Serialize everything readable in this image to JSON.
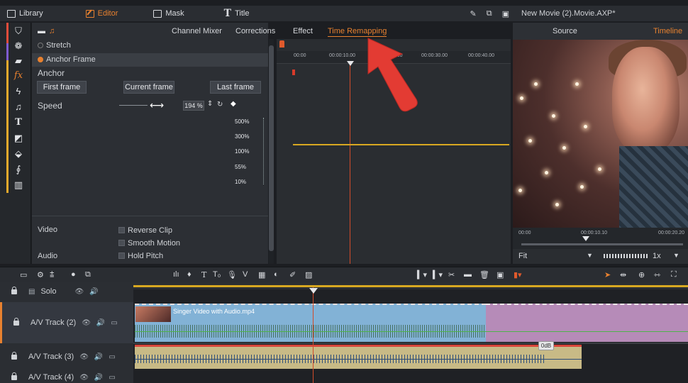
{
  "menubar": {
    "items": [
      {
        "label": "Library",
        "icon": "library-icon"
      },
      {
        "label": "Editor",
        "icon": "editor-pen-icon",
        "active": true
      },
      {
        "label": "Mask",
        "icon": "mask-icon"
      },
      {
        "label": "Title",
        "icon": "title-t-icon"
      }
    ],
    "right_icons": [
      "pencil-icon",
      "copy-icon",
      "layout-icon"
    ],
    "project_title": "New Movie (2).Movie.AXP*"
  },
  "panel": {
    "tabs": [
      "Channel Mixer",
      "Corrections",
      "Effect",
      "Time Remapping"
    ],
    "active_tab": "Time Remapping",
    "stretch_label": "Stretch",
    "anchor_frame_label": "Anchor Frame",
    "anchor_label": "Anchor",
    "first_frame": "First frame",
    "current_frame": "Current frame",
    "last_frame": "Last frame",
    "speed_label": "Speed",
    "speed_value": "194 %",
    "speed_scale": [
      "500%",
      "300%",
      "100%",
      "55%",
      "10%"
    ],
    "video_label": "Video",
    "audio_label": "Audio",
    "reverse_clip": "Reverse Clip",
    "smooth_motion": "Smooth Motion",
    "hold_pitch": "Hold Pitch"
  },
  "graph": {
    "ruler_times": [
      "00:00",
      "00:00:10.00",
      "00:00",
      "00:00:30.00",
      "00:00:40.00"
    ]
  },
  "preview": {
    "tabs": [
      "Source",
      "Timeline"
    ],
    "active_tab": "Timeline",
    "ruler_times": [
      "00:00",
      "00:00:10.10",
      "00:00:20.20"
    ],
    "fit_label": "Fit",
    "speed_label": "1x"
  },
  "timeline": {
    "tracks": [
      {
        "label": "Solo"
      },
      {
        "label": "A/V Track (2)"
      },
      {
        "label": "A/V Track (3)"
      },
      {
        "label": "A/V Track (4)"
      }
    ],
    "clip_name": "Singer Video with Audio.mp4",
    "db_label": "0dB"
  },
  "colors": {
    "accent": "#e8812f",
    "playhead": "#d24b2a",
    "speed_line": "#d8a821",
    "video_clip": "#82b2d6",
    "audio_clip": "#c8ba86"
  }
}
